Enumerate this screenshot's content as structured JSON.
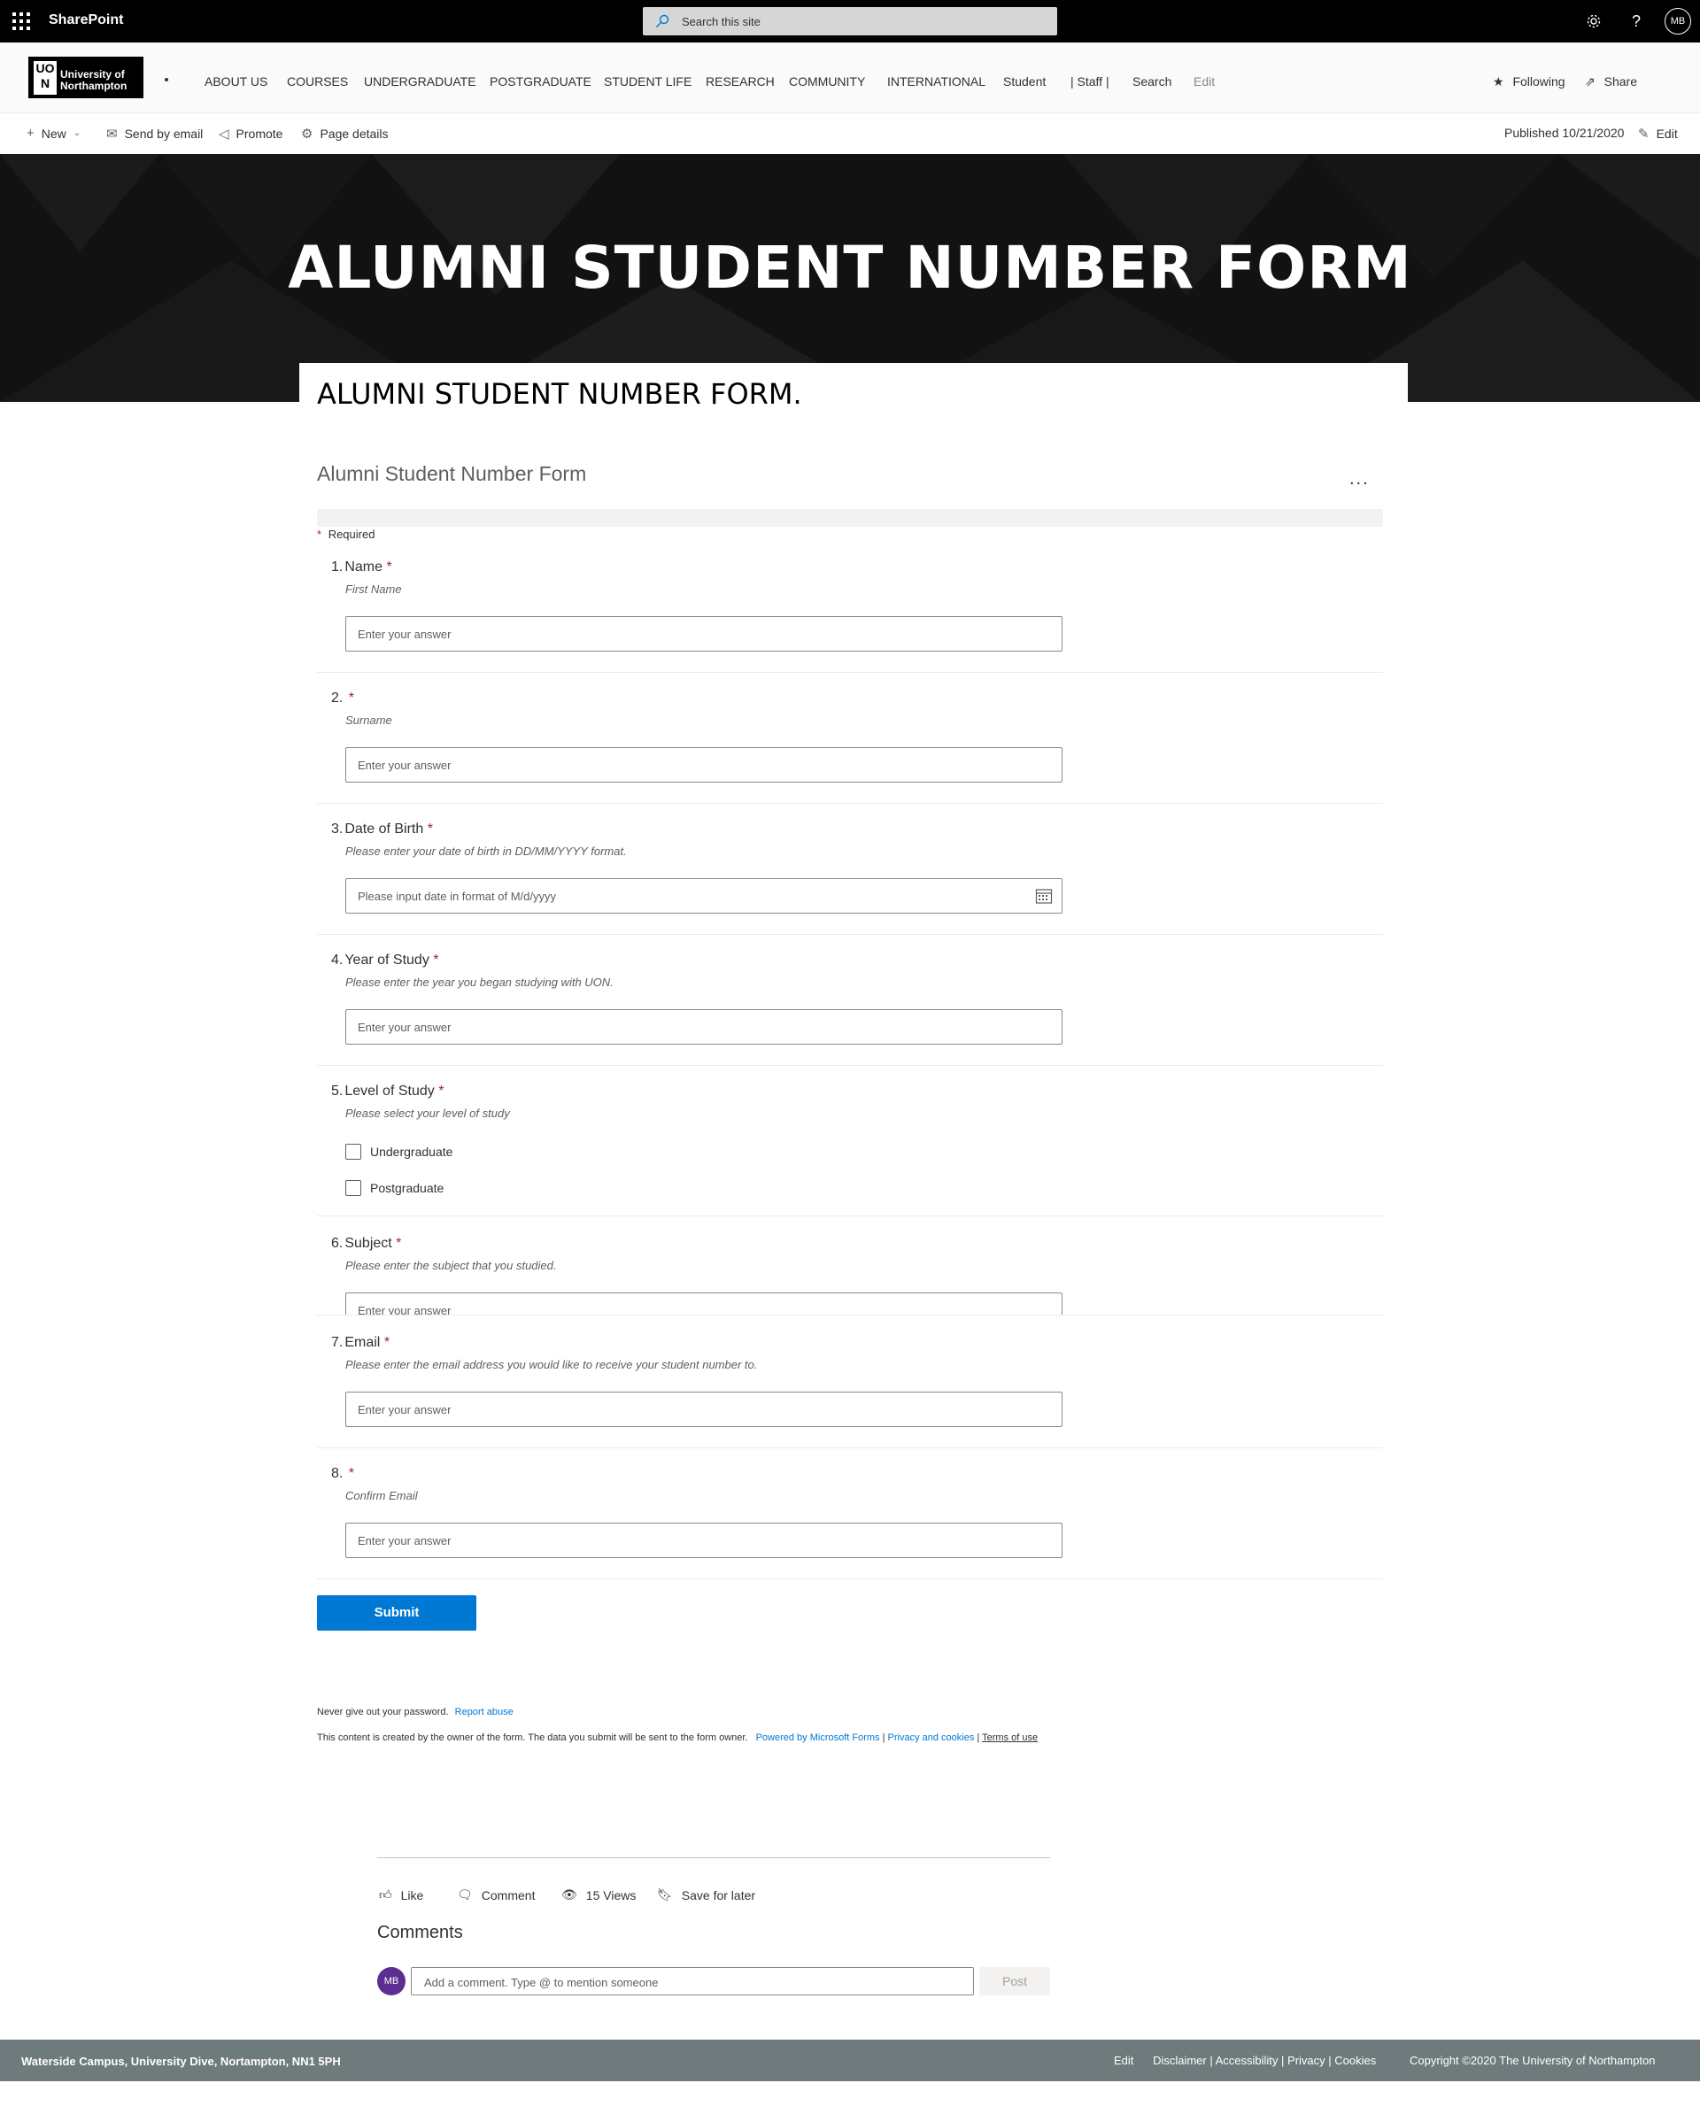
{
  "suite": {
    "brand": "SharePoint",
    "search_placeholder": "Search this site",
    "settings_icon": "gear-icon",
    "help_label": "?",
    "avatar_initials": "MB"
  },
  "site": {
    "logo_mark": "UO\nN",
    "logo_line1": "University of",
    "logo_line2": "Northampton",
    "nav": [
      {
        "label": "ABOUT US"
      },
      {
        "label": "COURSES"
      },
      {
        "label": "UNDERGRADUATE"
      },
      {
        "label": "POSTGRADUATE"
      },
      {
        "label": "STUDENT LIFE"
      },
      {
        "label": "RESEARCH"
      },
      {
        "label": "COMMUNITY"
      },
      {
        "label": "INTERNATIONAL"
      },
      {
        "label": "Student"
      },
      {
        "label": "| Staff |"
      },
      {
        "label": "Search"
      },
      {
        "label": "Edit"
      }
    ],
    "following_label": "Following",
    "share_label": "Share"
  },
  "commandbar": {
    "new_label": "New",
    "send_label": "Send by email",
    "promote_label": "Promote",
    "details_label": "Page details",
    "published_label": "Published 10/21/2020",
    "edit_label": "Edit"
  },
  "hero": {
    "title": "ALUMNI STUDENT NUMBER FORM"
  },
  "content": {
    "heading": "ALUMNI STUDENT NUMBER FORM."
  },
  "form": {
    "title": "Alumni Student Number Form",
    "more_label": "...",
    "required_note": "Required",
    "questions": [
      {
        "num": "1.",
        "title": "Name",
        "subtitle": "First Name",
        "placeholder": "Enter your answer"
      },
      {
        "num": "2.",
        "title": "",
        "subtitle": "Surname",
        "placeholder": "Enter your answer"
      },
      {
        "num": "3.",
        "title": "Date of Birth",
        "subtitle": "Please enter your date of birth in DD/MM/YYYY format.",
        "placeholder": "Please input date in format of M/d/yyyy"
      },
      {
        "num": "4.",
        "title": "Year of Study",
        "subtitle": "Please enter the year you began studying with UON.",
        "placeholder": "Enter your answer"
      },
      {
        "num": "5.",
        "title": "Level of Study",
        "subtitle": "Please select your level of study",
        "options": [
          "Undergraduate",
          "Postgraduate"
        ]
      },
      {
        "num": "6.",
        "title": "Subject",
        "subtitle": "Please enter the subject that you studied.",
        "placeholder": "Enter your answer"
      },
      {
        "num": "7.",
        "title": "Email",
        "subtitle": "Please enter the email address you would like to receive your student number to.",
        "placeholder": "Enter your answer"
      },
      {
        "num": "8.",
        "title": "",
        "subtitle": "Confirm Email",
        "placeholder": "Enter your answer"
      }
    ],
    "submit_label": "Submit",
    "footnote1": "Never give out your password.",
    "report_abuse": "Report abuse",
    "footnote2": "This content is created by the owner of the form. The data you submit will be sent to the form owner.",
    "powered_by": "Powered by Microsoft Forms",
    "privacy": "Privacy and cookies",
    "terms": "Terms of use"
  },
  "social": {
    "like_label": "Like",
    "comment_label": "Comment",
    "views_label": "15 Views",
    "save_label": "Save for later",
    "comments_heading": "Comments",
    "avatar_initials": "MB",
    "comment_placeholder": "Add a comment. Type @ to mention someone",
    "post_label": "Post"
  },
  "footer": {
    "address": "Waterside Campus, University Dive, Nortampton, NN1 5PH",
    "links": "Edit      Disclaimer | Accessibility | Privacy | Cookies",
    "copyright": "Copyright ©2020 The University of Northampton"
  },
  "colors": {
    "accent": "#0078d4",
    "required": "#a4262c",
    "footer_bg": "#6e7a7c",
    "comment_avatar": "#5c2e91"
  }
}
